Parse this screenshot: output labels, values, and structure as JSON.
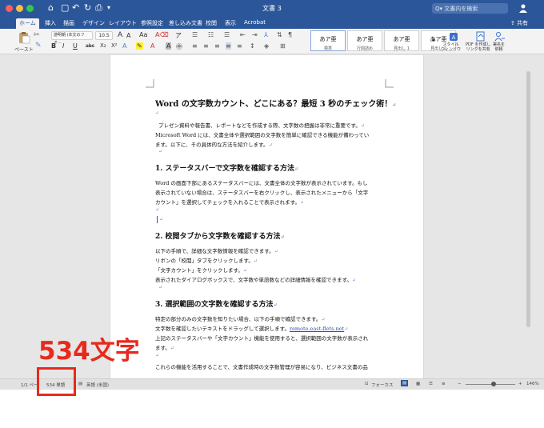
{
  "titlebar": {
    "document_title": "文書 3",
    "search_placeholder": "Q▾ 文書内を検索",
    "quick_access": [
      "⌂",
      "▢",
      "↶",
      "↻",
      "⎙",
      "▾"
    ]
  },
  "ribbon_tabs": [
    "ホーム",
    "挿入",
    "描画",
    "デザイン",
    "レイアウト",
    "参照設定",
    "差し込み文書",
    "校閲",
    "表示",
    "Acrobat"
  ],
  "share_label": "⇪ 共有",
  "ribbon": {
    "paste_label": "ペースト",
    "font_name": "游明朝 (本文のフォ...",
    "font_size": "10.5",
    "format_buttons": [
      "B",
      "I",
      "U",
      "abc",
      "X₂",
      "X²"
    ],
    "styles": [
      {
        "label": "あア亜",
        "name": "標準"
      },
      {
        "label": "あア亜",
        "name": "行間詰め"
      },
      {
        "label": "あア亜",
        "name": "見出し 1"
      },
      {
        "label": "あア亜",
        "name": "見出し 2"
      }
    ],
    "style_pane": "スタイル\nウィンドウ",
    "pdf_share": "PDF を作成し\nリンクを共有",
    "sign_label": "署名を\n依頼"
  },
  "document": {
    "title": "Word の文字数カウント、どこにある？最短 3 秒のチェック術！",
    "intro_1": "プレゼン資料や報告書、レポートなどを作成する際、文字数の把握は非常に重要です。",
    "intro_2": "Microsoft Word には、文書全体や選択範囲の文字数を簡単に確認できる機能が備わってい",
    "intro_3": "ます。以下に、その具体的な方法を紹介します。",
    "s1_heading": "1. ステータスバーで文字数を確認する方法",
    "s1_p1": "Word の画面下部にあるステータスバーには、文書全体の文字数が表示されています。もし",
    "s1_p2": "表示されていない場合は、ステータスバーを右クリックし、表示されたメニューから「文字",
    "s1_p3": "カウント」を選択してチェックを入れることで表示されます。",
    "s2_heading": "2. 校閲タブから文字数を確認する方法",
    "s2_p1": "以下の手順で、詳細な文字数情報を確認できます。",
    "s2_p2": "リボンの「校閲」タブをクリックします。",
    "s2_p3": "「文字カウント」をクリックします。",
    "s2_p4": "表示されたダイアログボックスで、文字数や単語数などの詳細情報を確認できます。",
    "s3_heading": "3. 選択範囲の文字数を確認する方法",
    "s3_p1": "特定の部分のみの文字数を知りたい場合、以下の手順で確認できます。",
    "s3_p2": "文字数を確認したいテキストをドラッグして選択します。",
    "s3_link": "remote.east-flets.net",
    "s3_p3": "上記のステータスバーや「文字カウント」機能を使用すると、選択範囲の文字数が表示され",
    "s3_p4": "ます。",
    "closing": "これらの機能を活用することで、文書作成時の文字数管理が容易になり、ビジネス文書の品",
    "para_mark": "↵"
  },
  "statusbar": {
    "page": "1/1 ペー",
    "word_count": "534 単語",
    "language": "英語 (米国)",
    "focus": "フォーカス",
    "zoom": "146%"
  },
  "annotation": {
    "label": "534文字"
  },
  "colors": {
    "accent": "#2b579a",
    "annotation": "#e8291c"
  }
}
